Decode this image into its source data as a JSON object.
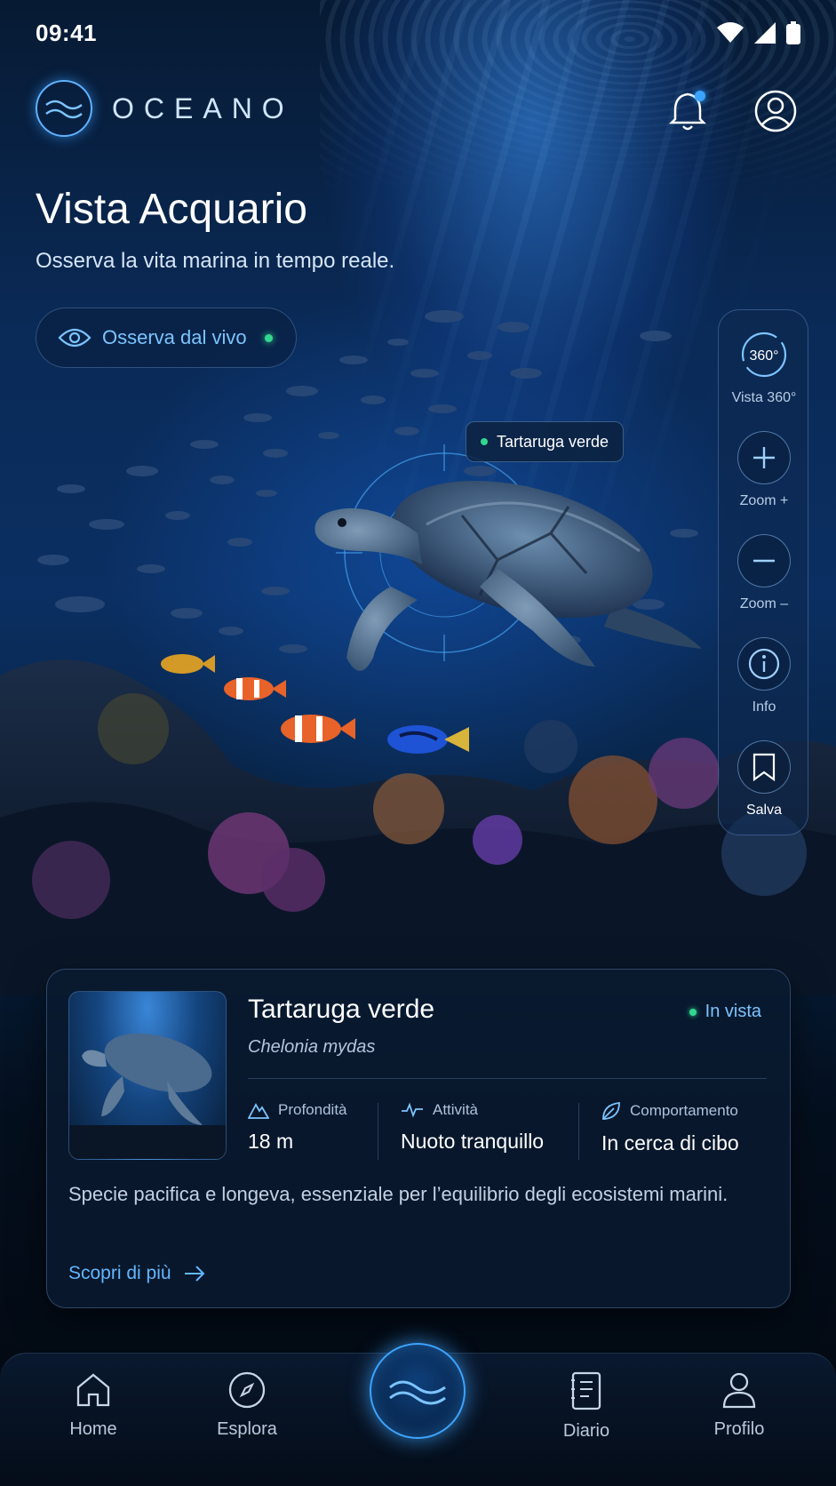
{
  "status_bar": {
    "time": "09:41"
  },
  "header": {
    "brand": "OCEANO"
  },
  "hero": {
    "title": "Vista Acquario",
    "subtitle": "Osserva la vita marina in tempo reale.",
    "live_button": "Osserva dal vivo"
  },
  "controls": [
    {
      "id": "vista360",
      "icon": "rotate-360-icon",
      "icon_text": "360°",
      "label": "Vista 360°"
    },
    {
      "id": "zoom_in",
      "icon": "plus-icon",
      "label": "Zoom +"
    },
    {
      "id": "zoom_out",
      "icon": "minus-icon",
      "label": "Zoom –"
    },
    {
      "id": "info",
      "icon": "info-icon",
      "label": "Info"
    },
    {
      "id": "save",
      "icon": "bookmark-icon",
      "label": "Salva"
    }
  ],
  "tag": {
    "label": "Tartaruga verde"
  },
  "card": {
    "name": "Tartaruga verde",
    "scientific_name": "Chelonia mydas",
    "badge": "In vista",
    "stats": [
      {
        "icon": "mountain-icon",
        "label": "Profondità",
        "value": "18 m"
      },
      {
        "icon": "activity-icon",
        "label": "Attività",
        "value": "Nuoto tranquillo"
      },
      {
        "icon": "leaf-icon",
        "label": "Comportamento",
        "value": "In cerca di cibo"
      }
    ],
    "description": "Specie pacifica e longeva, essenziale per l’equilibrio degli ecosistemi marini.",
    "more_link": "Scopri di più"
  },
  "nav": {
    "items": [
      {
        "icon": "home-icon",
        "label": "Home"
      },
      {
        "icon": "compass-icon",
        "label": "Esplora"
      },
      {
        "icon": "notebook-icon",
        "label": "Diario"
      },
      {
        "icon": "user-icon",
        "label": "Profilo"
      }
    ],
    "center_icon": "wave-logo-icon"
  },
  "colors": {
    "accent": "#3ea4ff",
    "live_green": "#32d78f",
    "link": "#63b6ff",
    "background": "#071a33"
  }
}
